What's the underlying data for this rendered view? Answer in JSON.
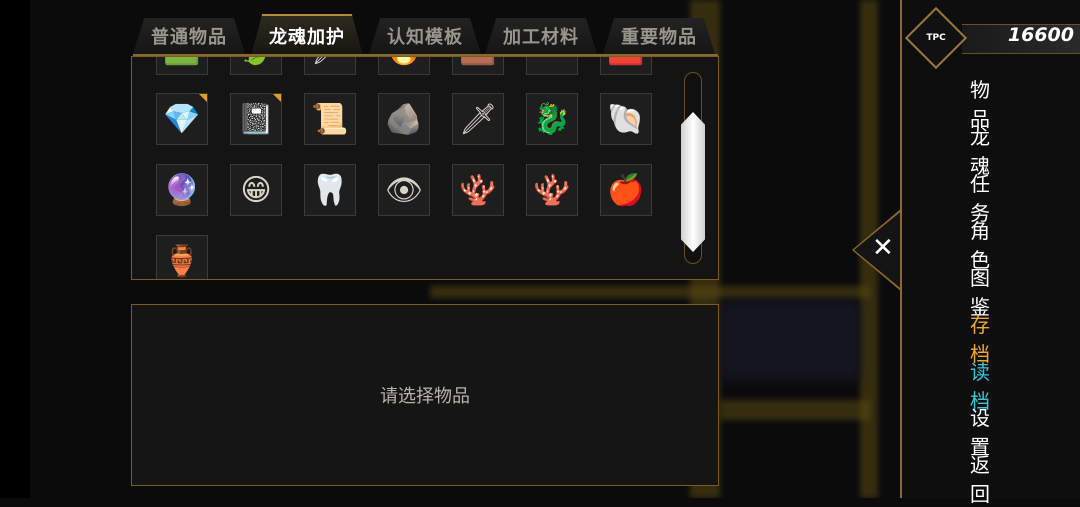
{
  "tabs": [
    {
      "label": "普通物品",
      "active": false
    },
    {
      "label": "龙魂加护",
      "active": true
    },
    {
      "label": "认知模板",
      "active": false
    },
    {
      "label": "加工材料",
      "active": false
    },
    {
      "label": "重要物品",
      "active": false
    }
  ],
  "items_row_partial": [
    {
      "icon": "green-gem-icon",
      "glyph": "🟩"
    },
    {
      "icon": "green-leaf-icon",
      "glyph": "🍃"
    },
    {
      "icon": "dagger-hilt-icon",
      "glyph": "🗡"
    },
    {
      "icon": "torch-icon",
      "glyph": "🔥"
    },
    {
      "icon": "brown-item-icon",
      "glyph": "🟫"
    },
    {
      "icon": "stone-dish-icon",
      "glyph": "⚪"
    },
    {
      "icon": "red-scroll-icon",
      "glyph": "🟥"
    }
  ],
  "items_row_1": [
    {
      "icon": "crystal-cluster-icon",
      "glyph": "💎",
      "new": true
    },
    {
      "icon": "dark-book-icon",
      "glyph": "📓",
      "new": true
    },
    {
      "icon": "parchment-scroll-icon",
      "glyph": "📜",
      "new": false
    },
    {
      "icon": "blue-ore-icon",
      "glyph": "🪨",
      "new": false
    },
    {
      "icon": "curved-dagger-icon",
      "glyph": "🗡",
      "new": false
    },
    {
      "icon": "dragon-head-icon",
      "glyph": "🐉",
      "new": false
    },
    {
      "icon": "golden-scale-icon",
      "glyph": "🐚",
      "new": false
    }
  ],
  "items_row_2": [
    {
      "icon": "crystal-pendant-icon",
      "glyph": "🔮"
    },
    {
      "icon": "grinning-face-icon",
      "glyph": "😁"
    },
    {
      "icon": "claw-fang-icon",
      "glyph": "🦷"
    },
    {
      "icon": "dragon-eye-icon",
      "glyph": "👁"
    },
    {
      "icon": "red-coral-icon",
      "glyph": "🪸"
    },
    {
      "icon": "dark-coral-icon",
      "glyph": "🪸"
    },
    {
      "icon": "red-apple-icon",
      "glyph": "🍎"
    }
  ],
  "items_row_3": [
    {
      "icon": "clay-pot-icon",
      "glyph": "🏺"
    }
  ],
  "description": {
    "hint": "请选择物品"
  },
  "currency": {
    "icon_label": "TPC",
    "amount": "16600"
  },
  "menu": {
    "items": [
      {
        "label": "物品"
      },
      {
        "label": "龙魂"
      },
      {
        "label": "任务"
      },
      {
        "label": "角色"
      },
      {
        "label": "图鉴"
      },
      {
        "label": "存档"
      },
      {
        "label": "读档"
      },
      {
        "label": "设置"
      },
      {
        "label": "返回"
      }
    ],
    "close_glyph": "✕"
  },
  "colors": {
    "accent_gold": "#8a6a2a",
    "save": "#f0a72e",
    "load": "#35c6d8"
  }
}
